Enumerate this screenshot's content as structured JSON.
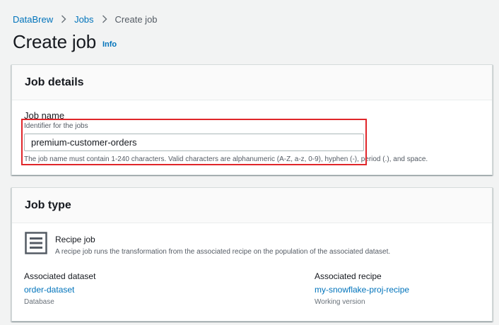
{
  "breadcrumb": {
    "items": [
      "DataBrew",
      "Jobs",
      "Create job"
    ]
  },
  "header": {
    "title": "Create job",
    "info_label": "Info"
  },
  "job_details": {
    "heading": "Job details",
    "job_name": {
      "label": "Job name",
      "description": "Identifier for the jobs",
      "value": "premium-customer-orders",
      "constraint": "The job name must contain 1-240 characters. Valid characters are alphanumeric (A-Z, a-z, 0-9), hyphen (-), period (.), and space."
    }
  },
  "job_type": {
    "heading": "Job type",
    "icon": "recipe-list-icon",
    "recipe_job": {
      "title": "Recipe job",
      "description": "A recipe job runs the transformation from the associated recipe on the population of the associated dataset."
    },
    "associated_dataset": {
      "label": "Associated dataset",
      "value": "order-dataset",
      "sub": "Database"
    },
    "associated_recipe": {
      "label": "Associated recipe",
      "value": "my-snowflake-proj-recipe",
      "sub": "Working version"
    }
  },
  "colors": {
    "link": "#0073bb",
    "highlight": "#e0262a",
    "background": "#f2f3f3"
  }
}
